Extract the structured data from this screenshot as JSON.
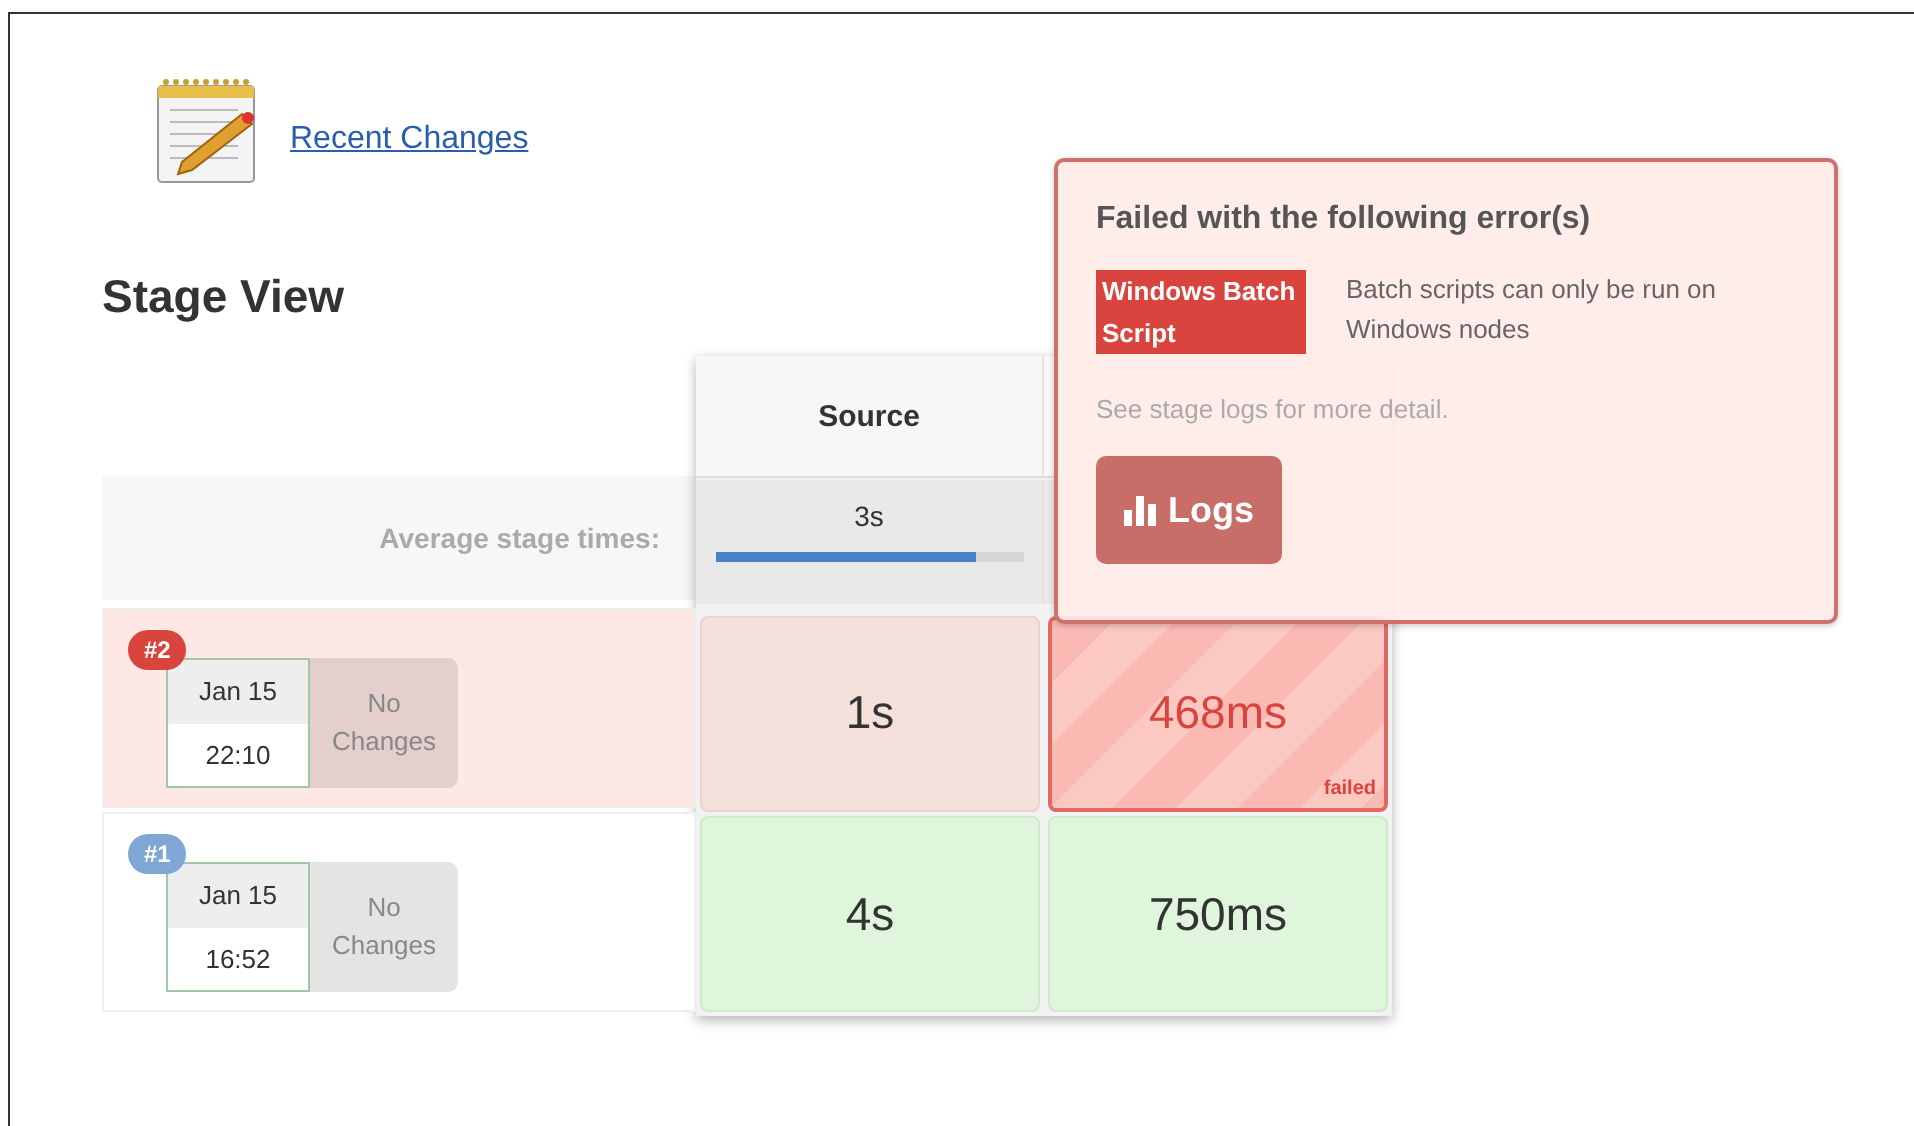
{
  "link": {
    "label": "Recent Changes"
  },
  "title": "Stage View",
  "average_label": "Average stage times:",
  "stages": [
    {
      "name": "Source",
      "average": "3s",
      "level": 0.85
    }
  ],
  "runs": [
    {
      "number": "#2",
      "failed": true,
      "date": "Jan 15",
      "time": "22:10",
      "changes": "No Changes",
      "cells": [
        {
          "failed": false,
          "duration": "1s"
        },
        {
          "failed": true,
          "duration": "468ms",
          "label": "failed"
        }
      ]
    },
    {
      "number": "#1",
      "failed": false,
      "date": "Jan 15",
      "time": "16:52",
      "changes": "No Changes",
      "cells": [
        {
          "failed": false,
          "duration": "4s"
        },
        {
          "failed": false,
          "duration": "750ms"
        }
      ]
    }
  ],
  "popup": {
    "title": "Failed with the following error(s)",
    "tag": "Windows Batch Script",
    "message": "Batch scripts can only be run on Windows nodes",
    "hint": "See stage logs for more detail.",
    "button": "Logs"
  }
}
